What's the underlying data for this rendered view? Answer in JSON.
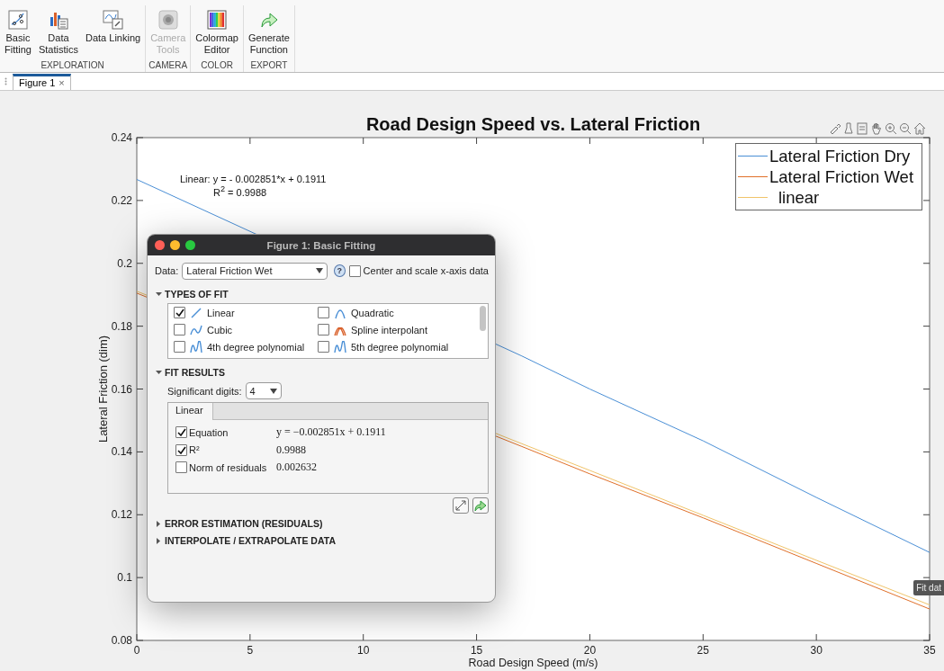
{
  "toolbar": {
    "groups": [
      {
        "label": "EXPLORATION",
        "buttons": [
          {
            "label": "Basic\nFitting",
            "kind": "fitting",
            "disabled": false
          },
          {
            "label": "Data\nStatistics",
            "kind": "statistics",
            "disabled": false
          },
          {
            "label": "Data Linking",
            "kind": "linking",
            "disabled": false
          }
        ]
      },
      {
        "label": "CAMERA",
        "buttons": [
          {
            "label": "Camera\nTools",
            "kind": "camera",
            "disabled": true
          }
        ]
      },
      {
        "label": "COLOR",
        "buttons": [
          {
            "label": "Colormap\nEditor",
            "kind": "colormap",
            "disabled": false
          }
        ]
      },
      {
        "label": "EXPORT",
        "buttons": [
          {
            "label": "Generate\nFunction",
            "kind": "export",
            "disabled": false
          }
        ]
      }
    ]
  },
  "document_tabs": [
    {
      "label": "Figure 1",
      "close": "×",
      "selected": true
    }
  ],
  "figure": {
    "chart_data": {
      "type": "line",
      "title": "Road Design Speed vs. Lateral Friction",
      "xlabel": "Road Design Speed (m/s)",
      "ylabel": "Lateral Friction (dim)",
      "x": [
        0,
        17,
        20,
        25,
        30,
        35
      ],
      "series": [
        {
          "name": "Lateral Friction Dry",
          "color": "#4a8fd6",
          "values": [
            0.2267,
            0.1705,
            0.16,
            0.1435,
            0.1255,
            0.108
          ]
        },
        {
          "name": "Lateral Friction Wet",
          "color": "#e0702a",
          "values": [
            0.1905,
            0.1417,
            0.133,
            0.119,
            0.1045,
            0.09
          ]
        },
        {
          "name": "linear",
          "color": "#f0c46a",
          "values": [
            0.1911,
            0.1426,
            0.1341,
            0.1198,
            0.1055,
            0.0913
          ]
        }
      ],
      "xlim": [
        0,
        35
      ],
      "ylim": [
        0.08,
        0.24
      ],
      "xticks": [
        0,
        5,
        10,
        15,
        20,
        25,
        30,
        35
      ],
      "yticks": [
        0.08,
        0.1,
        0.12,
        0.14,
        0.16,
        0.18,
        0.2,
        0.22,
        0.24
      ],
      "annotations": [
        "Linear:  y = - 0.002851*x + 0.1911",
        "R$^{2}$ = 0.9988"
      ]
    },
    "tooltip": "Fit dat"
  },
  "dialog": {
    "title": "Figure 1: Basic Fitting",
    "data_label": "Data:",
    "data_value": "Lateral Friction Wet",
    "help": "?",
    "center_scale": {
      "label": "Center and scale x-axis data",
      "checked": false
    },
    "types_section": {
      "label": "TYPES OF FIT",
      "expanded": true
    },
    "fit_types": [
      {
        "label": "Linear",
        "kind": "linear",
        "checked": true
      },
      {
        "label": "Quadratic",
        "kind": "quadratic",
        "checked": false
      },
      {
        "label": "Cubic",
        "kind": "cubic",
        "checked": false
      },
      {
        "label": "Spline interpolant",
        "kind": "spline",
        "checked": false
      },
      {
        "label": "4th degree polynomial",
        "kind": "poly",
        "checked": false
      },
      {
        "label": "5th degree polynomial",
        "kind": "poly",
        "checked": false
      }
    ],
    "results_section": {
      "label": "FIT RESULTS",
      "expanded": true
    },
    "significant_digits": {
      "label": "Significant digits:",
      "value": "4"
    },
    "result_tabs": [
      {
        "label": "Linear",
        "selected": true
      }
    ],
    "results": [
      {
        "label": "Equation",
        "value": "y = −0.002851x + 0.1911",
        "checked": true
      },
      {
        "label": "R²",
        "value": "0.9988",
        "checked": true
      },
      {
        "label": "Norm of residuals",
        "value": "0.002632",
        "checked": false
      }
    ],
    "collapsed_sections": [
      {
        "label": "ERROR ESTIMATION (RESIDUALS)",
        "expanded": false
      },
      {
        "label": "INTERPOLATE / EXTRAPOLATE DATA",
        "expanded": false
      }
    ]
  }
}
